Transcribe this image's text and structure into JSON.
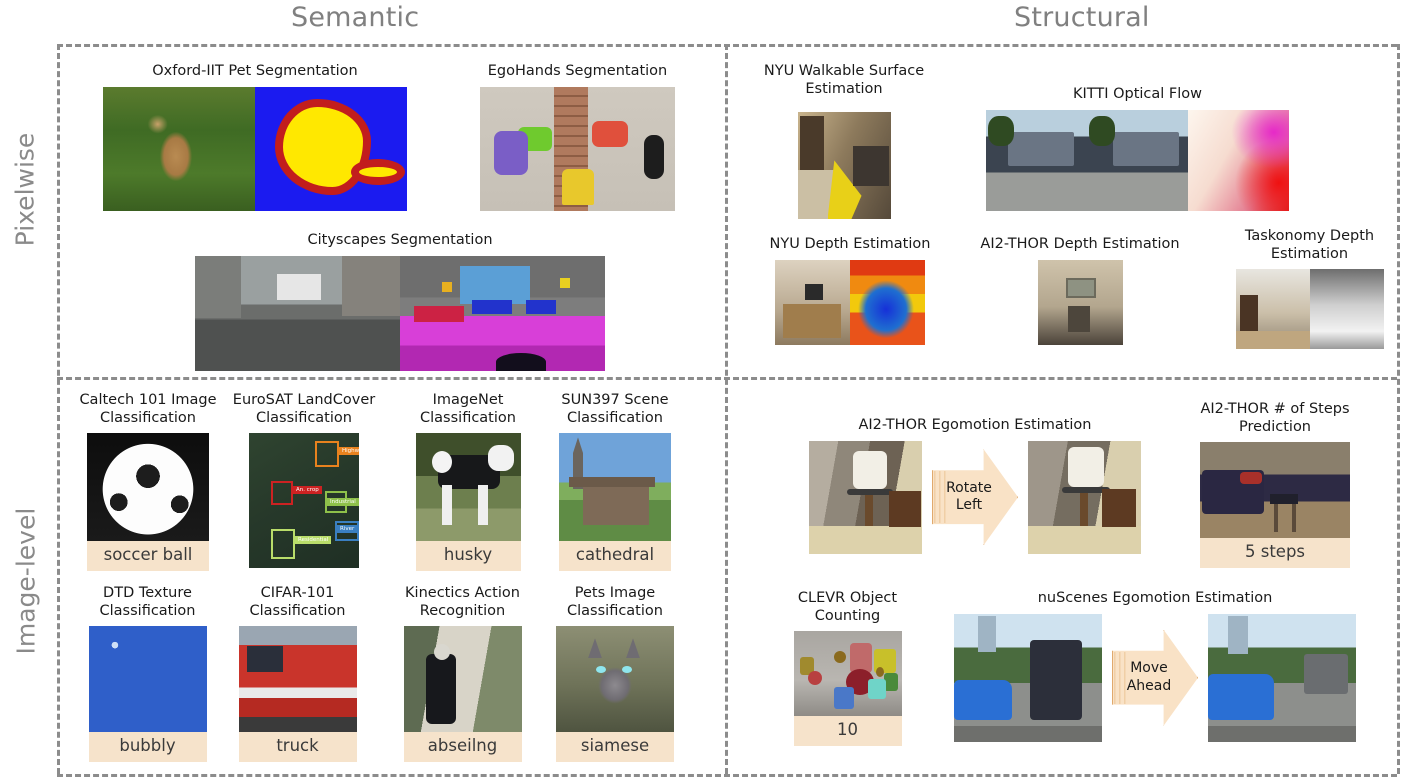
{
  "columns": {
    "semantic": "Semantic",
    "structural": "Structural"
  },
  "rows": {
    "pixelwise": "Pixelwise",
    "image_level": "Image-level"
  },
  "quadrants": {
    "semantic_pixelwise": {
      "tasks": [
        {
          "title": "Oxford-IIT Pet Segmentation",
          "panels": [
            "pet-photo",
            "pet-mask"
          ]
        },
        {
          "title": "EgoHands Segmentation",
          "panels": [
            "egohands-photo"
          ]
        },
        {
          "title": "Cityscapes Segmentation",
          "panels": [
            "cityscapes-photo",
            "cityscapes-mask"
          ]
        }
      ]
    },
    "structural_pixelwise": {
      "tasks": [
        {
          "title": "NYU Walkable Surface\nEstimation",
          "panels": [
            "nyu-walkable-photo"
          ]
        },
        {
          "title": "KITTI Optical Flow",
          "panels": [
            "kitti-frame1",
            "kitti-frame2",
            "kitti-flow"
          ]
        },
        {
          "title": "NYU Depth Estimation",
          "panels": [
            "nyu-depth-rgb",
            "nyu-depth-map"
          ]
        },
        {
          "title": "AI2-THOR Depth Estimation",
          "panels": [
            "thor-depth-photo"
          ]
        },
        {
          "title": "Taskonomy Depth\nEstimation",
          "panels": [
            "taskonomy-rgb",
            "taskonomy-depth"
          ]
        }
      ]
    },
    "semantic_image_level": {
      "tasks": [
        {
          "title": "Caltech 101 Image\nClassification",
          "label": "soccer ball"
        },
        {
          "title": "EuroSAT LandCover\nClassification",
          "label": null,
          "boxes": [
            {
              "tag": "Highway",
              "color": "#e8821e"
            },
            {
              "tag": "An. crop",
              "color": "#cc2222"
            },
            {
              "tag": "Industrial",
              "color": "#8ec04a"
            },
            {
              "tag": "River",
              "color": "#3a7fc1"
            },
            {
              "tag": "Residential",
              "color": "#b9dd6a"
            }
          ]
        },
        {
          "title": "ImageNet\nClassification",
          "label": "husky"
        },
        {
          "title": "SUN397 Scene\nClassification",
          "label": "cathedral"
        },
        {
          "title": "DTD Texture\nClassification",
          "label": "bubbly"
        },
        {
          "title": "CIFAR-101\nClassification",
          "label": "truck"
        },
        {
          "title": "Kinectics Action\nRecognition",
          "label": "abseilng"
        },
        {
          "title": "Pets Image\nClassification",
          "label": "siamese"
        }
      ]
    },
    "structural_image_level": {
      "tasks": [
        {
          "title": "AI2-THOR Egomotion Estimation",
          "action": "Rotate\nLeft"
        },
        {
          "title": "AI2-THOR # of Steps\nPrediction",
          "label": "5 steps"
        },
        {
          "title": "CLEVR Object\nCounting",
          "label": "10"
        },
        {
          "title": "nuScenes Egomotion Estimation",
          "action": "Move\nAhead"
        }
      ]
    }
  },
  "colors": {
    "label_chip_bg": "#f6e3cb",
    "arrow_fill": "#f9e2c6",
    "arrow_stroke": "#e0a96d",
    "dashed_border": "#8c8c8c",
    "header_text": "#808080"
  }
}
